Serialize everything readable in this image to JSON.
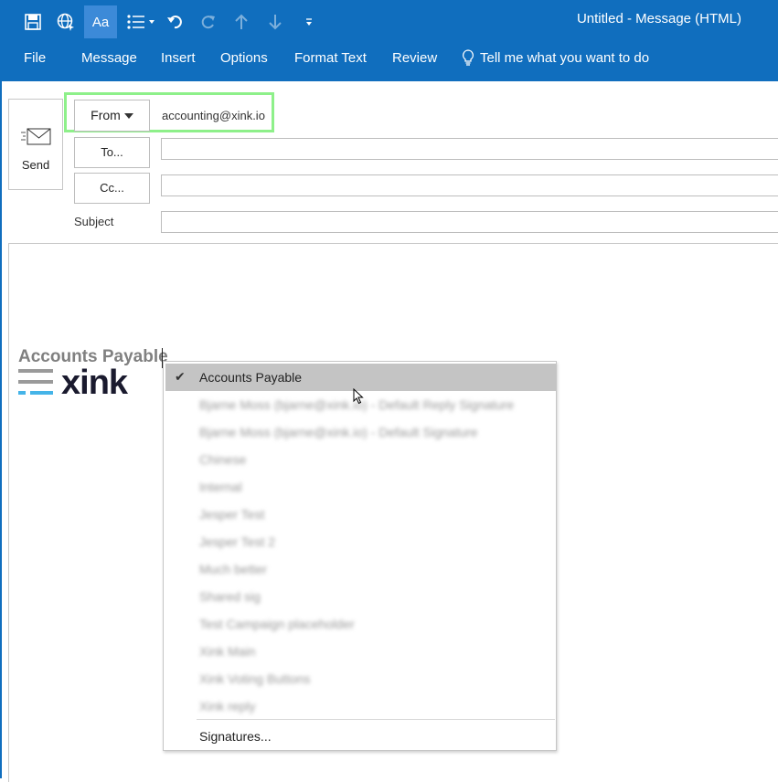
{
  "window": {
    "title": "Untitled  -  Message (HTML)"
  },
  "quick_access": {
    "items": [
      {
        "name": "save-icon"
      },
      {
        "name": "globe-icon"
      },
      {
        "name": "format-text-icon",
        "label": "Aa"
      },
      {
        "name": "bullets-icon"
      },
      {
        "name": "undo-icon"
      },
      {
        "name": "redo-icon"
      },
      {
        "name": "up-arrow-icon"
      },
      {
        "name": "down-arrow-icon"
      },
      {
        "name": "customize-icon"
      }
    ]
  },
  "ribbon": {
    "tabs": [
      "File",
      "Message",
      "Insert",
      "Options",
      "Format Text",
      "Review"
    ],
    "tell_me": "Tell me what you want to do"
  },
  "compose": {
    "send_label": "Send",
    "from_label": "From",
    "from_value": "accounting@xink.io",
    "to_label": "To...",
    "cc_label": "Cc...",
    "subject_label": "Subject"
  },
  "body": {
    "signature_name": "Accounts Payable",
    "logo_text": "xink"
  },
  "signature_menu": {
    "items": [
      {
        "label": "Accounts Payable",
        "checked": true,
        "blurred": false
      },
      {
        "label": "Bjarne Moss (bjarne@xink.io) - Default Reply Signature",
        "blurred": true
      },
      {
        "label": "Bjarne Moss (bjarne@xink.io) - Default Signature",
        "blurred": true
      },
      {
        "label": "Chinese",
        "blurred": true
      },
      {
        "label": "Internal",
        "blurred": true
      },
      {
        "label": "Jesper Test",
        "blurred": true
      },
      {
        "label": "Jesper Test 2",
        "blurred": true
      },
      {
        "label": "Much better",
        "blurred": true
      },
      {
        "label": "Shared sig",
        "blurred": true
      },
      {
        "label": "Test Campaign placeholder",
        "blurred": true
      },
      {
        "label": "Xink Main",
        "blurred": true
      },
      {
        "label": "Xink Voting Buttons",
        "blurred": true
      },
      {
        "label": "Xink reply",
        "blurred": true
      }
    ],
    "footer": "Signatures..."
  },
  "colors": {
    "ribbon_blue": "#106ebe",
    "highlight_green": "#8ef08a",
    "logo_gray": "#9a9a9a",
    "logo_blue": "#45b4e8"
  }
}
